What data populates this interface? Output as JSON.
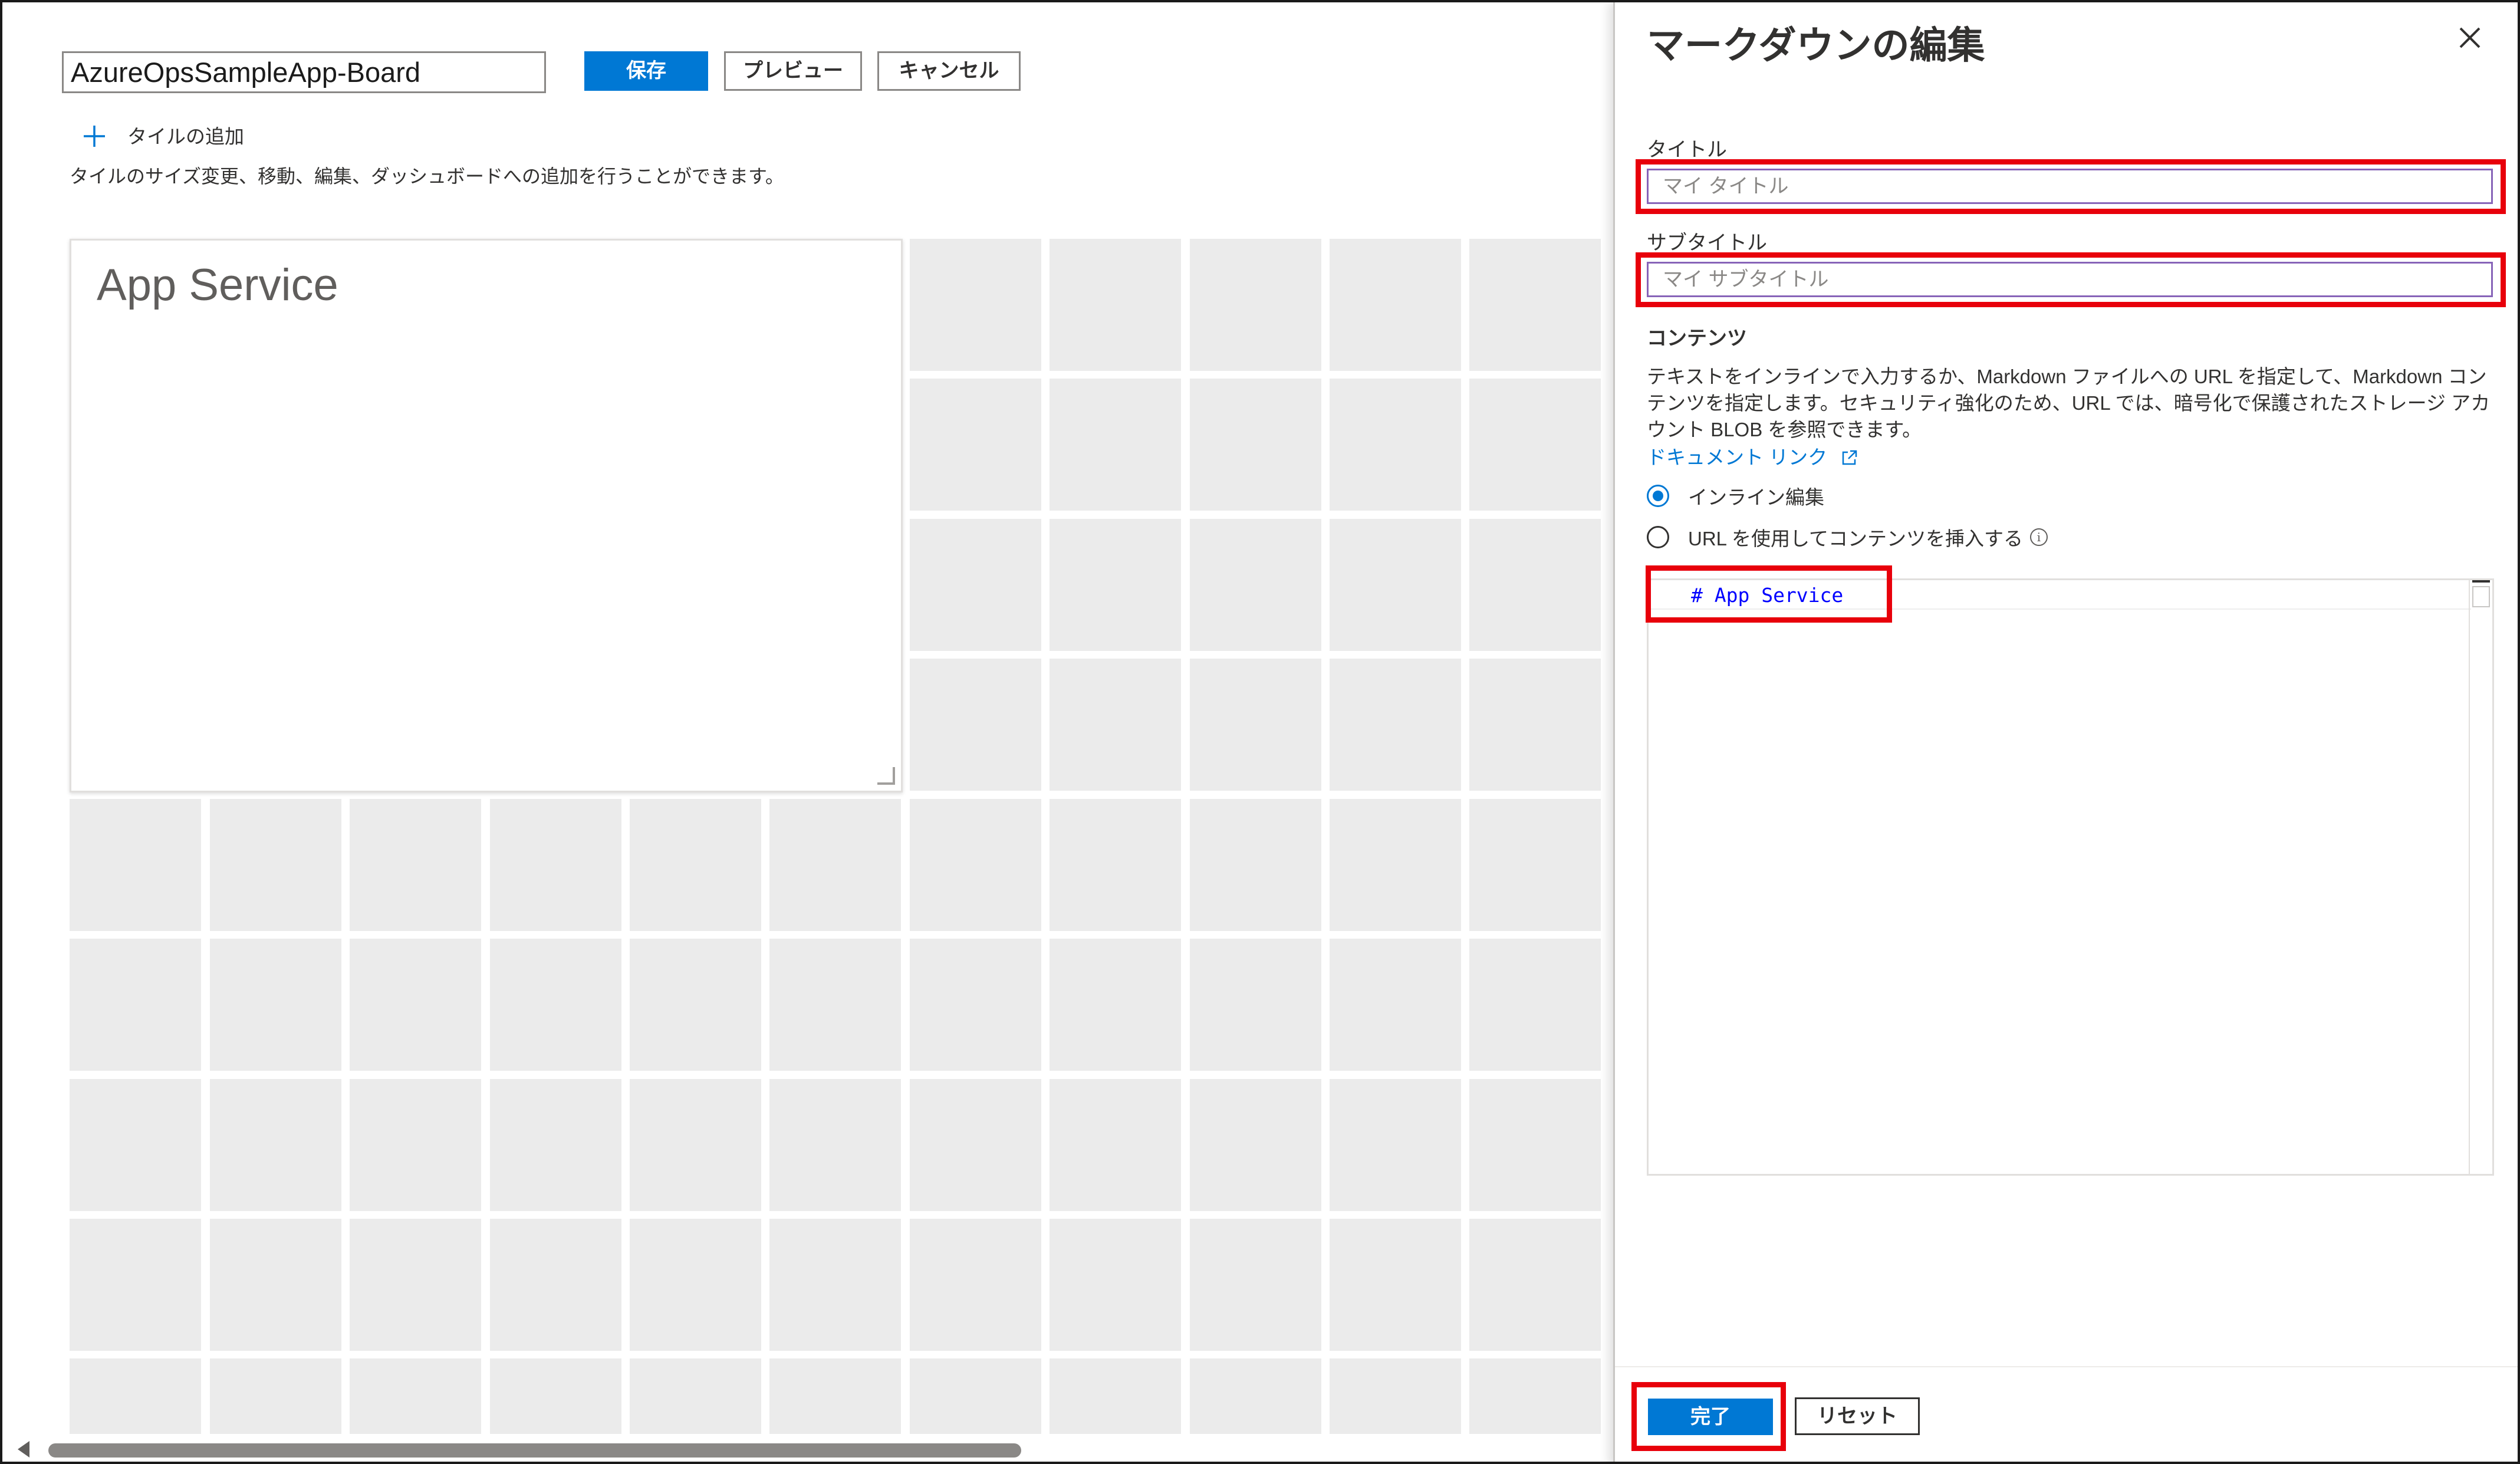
{
  "dashboard": {
    "name_value": "AzureOpsSampleApp-Board",
    "save_label": "保存",
    "preview_label": "プレビュー",
    "cancel_label": "キャンセル",
    "add_tile_label": "タイルの追加",
    "hint_text": "タイルのサイズ変更、移動、編集、ダッシュボードへの追加を行うことができます。",
    "tile_title": "App Service"
  },
  "panel": {
    "title": "マークダウンの編集",
    "title_label": "タイトル",
    "title_placeholder": "マイ タイトル",
    "subtitle_label": "サブタイトル",
    "subtitle_placeholder": "マイ サブタイトル",
    "content_label": "コンテンツ",
    "content_description": "テキストをインラインで入力するか、Markdown ファイルへの URL を指定して、Markdown コンテンツを指定します。セキュリティ強化のため、URL では、暗号化で保護されたストレージ アカウント BLOB を参照できます。",
    "doc_link": "ドキュメント リンク",
    "radio_inline": "インライン編集",
    "radio_url": "URL を使用してコンテンツを挿入する",
    "editor_code": "# App Service",
    "done_label": "完了",
    "reset_label": "リセット"
  },
  "colors": {
    "accent": "#0078d4",
    "highlight": "#e8000b",
    "input_focus_border": "#8764b8",
    "grid_cell": "#ebebeb"
  },
  "icons": [
    "plus-icon",
    "close-icon",
    "external-link-icon",
    "info-icon",
    "resize-grip-icon",
    "scroll-left-arrow-icon"
  ]
}
